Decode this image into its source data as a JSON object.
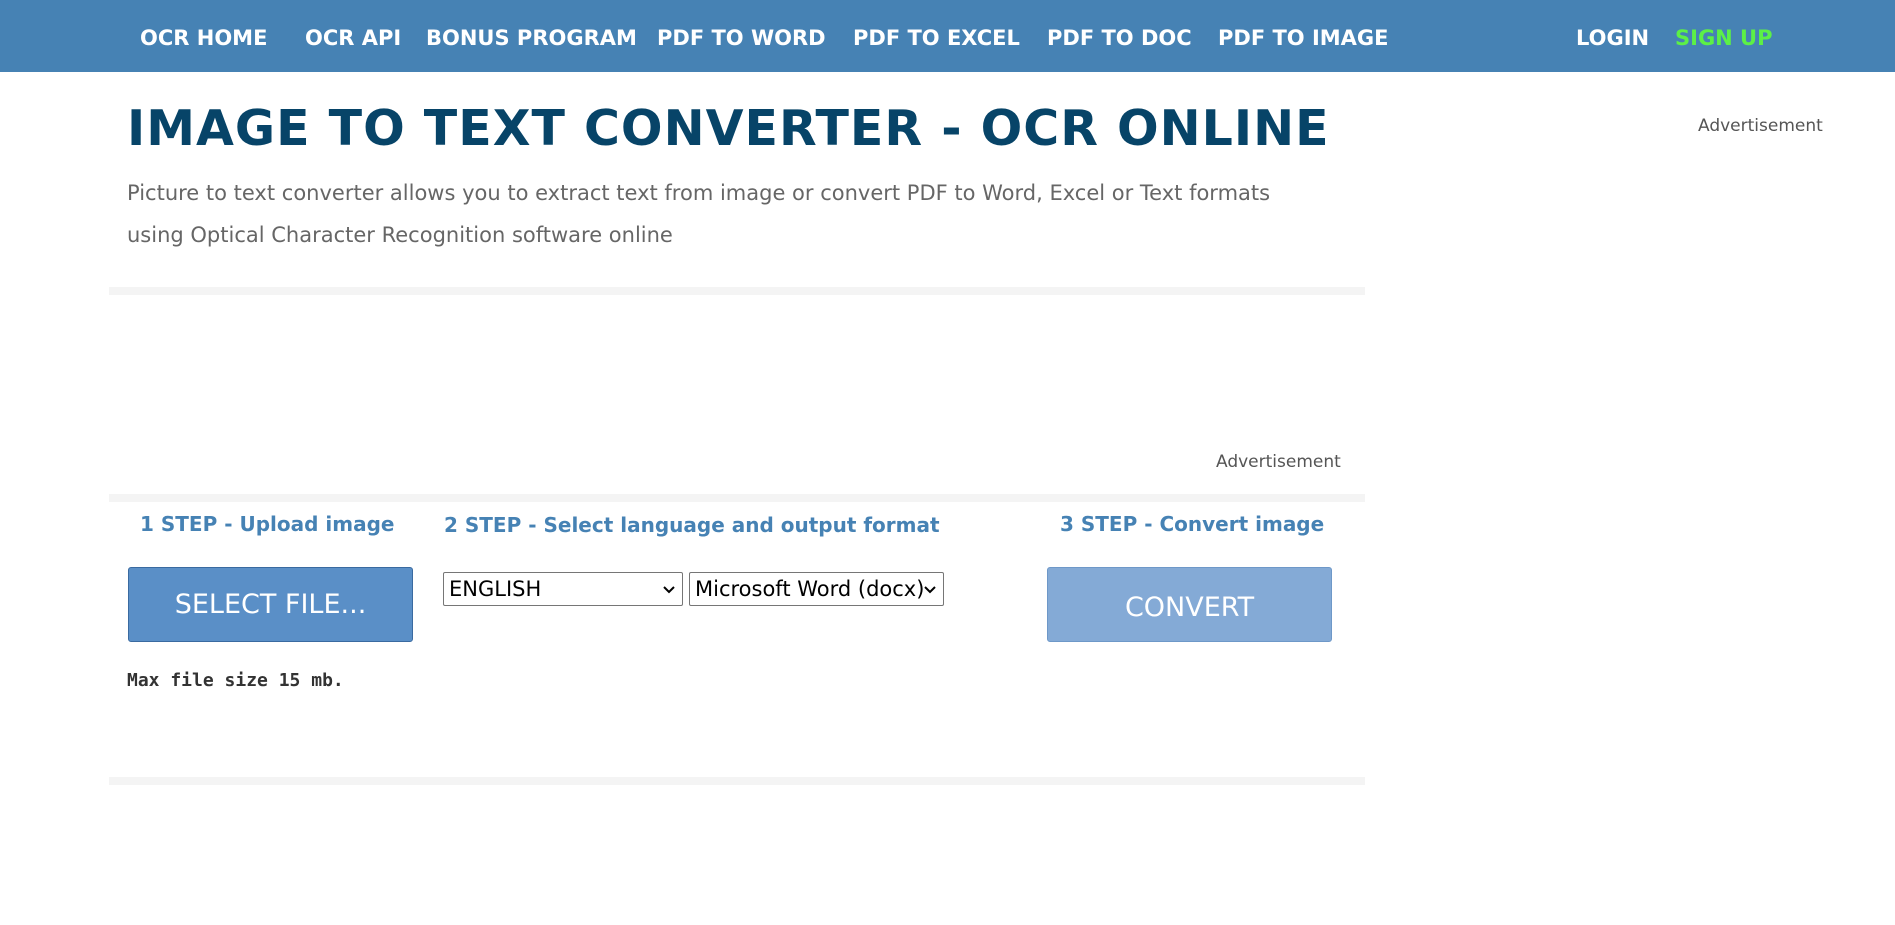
{
  "nav": {
    "items": [
      {
        "label": "OCR HOME"
      },
      {
        "label": "OCR API"
      },
      {
        "label": "BONUS PROGRAM"
      },
      {
        "label": "PDF TO WORD"
      },
      {
        "label": "PDF TO EXCEL"
      },
      {
        "label": "PDF TO DOC"
      },
      {
        "label": "PDF TO IMAGE"
      }
    ],
    "login": "LOGIN",
    "signup": "SIGN UP"
  },
  "colors": {
    "topbar": "#4682b4",
    "title": "#074468",
    "accent": "#4682b4",
    "signup": "#5cf046",
    "select_button": "#5a8fc7",
    "convert_button": "#84aad6"
  },
  "main": {
    "title": "IMAGE TO TEXT CONVERTER - OCR ONLINE",
    "subtitle": "Picture to text converter allows you to extract text from image or convert PDF to Word, Excel or Text formats using Optical Character Recognition software online"
  },
  "ads": {
    "side_label": "Advertisement",
    "inline_label": "Advertisement"
  },
  "steps": {
    "step1": {
      "label": "1 STEP - Upload image",
      "button": "SELECT FILE..."
    },
    "step2": {
      "label": "2 STEP - Select language and output format",
      "language": "ENGLISH",
      "format": "Microsoft Word (docx)"
    },
    "step3": {
      "label": "3 STEP - Convert image",
      "button": "CONVERT"
    }
  },
  "note": "Max file size 15 mb.",
  "icons": {
    "language_dropdown": "chevron-down-icon",
    "format_dropdown": "chevron-down-icon"
  }
}
